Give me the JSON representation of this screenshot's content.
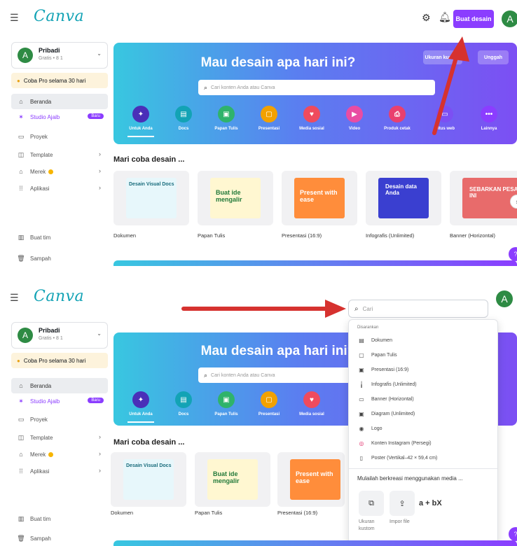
{
  "header": {
    "logo": "Canva",
    "create_button": "Buat desain",
    "avatar_letter": "A",
    "icons": [
      "menu-icon",
      "gear-icon",
      "bell-icon"
    ]
  },
  "sidebar": {
    "account": {
      "avatar_letter": "A",
      "name": "Pribadi",
      "plan": "Gratis • 8 1"
    },
    "pro_promo": "Coba Pro selama 30 hari",
    "items": [
      {
        "label": "Beranda",
        "icon": "home-icon"
      },
      {
        "label": "Studio Ajaib",
        "icon": "sparkle-icon",
        "badge": "Baru"
      },
      {
        "label": "Proyek",
        "icon": "folder-icon"
      },
      {
        "label": "Template",
        "icon": "template-icon"
      },
      {
        "label": "Merek",
        "icon": "brand-icon"
      },
      {
        "label": "Aplikasi",
        "icon": "apps-icon"
      }
    ],
    "footer_items": [
      {
        "label": "Buat tim",
        "icon": "team-icon"
      },
      {
        "label": "Sampah",
        "icon": "trash-icon"
      }
    ]
  },
  "hero": {
    "title": "Mau desain apa hari ini?",
    "search_placeholder": "Cari konten Anda atau Canva",
    "custom_size_button": "Ukuran kustom",
    "upload_button": "Unggah",
    "categories": [
      {
        "label": "Untuk Anda",
        "icon": "sparkle-icon",
        "color": "#4a2fb8"
      },
      {
        "label": "Docs",
        "icon": "docs-icon",
        "color": "#13a3b5"
      },
      {
        "label": "Papan Tulis",
        "icon": "whiteboard-icon",
        "color": "#2fb36b"
      },
      {
        "label": "Presentasi",
        "icon": "presentation-icon",
        "color": "#f2a100"
      },
      {
        "label": "Media sosial",
        "icon": "heart-icon",
        "color": "#ef4b5d"
      },
      {
        "label": "Video",
        "icon": "video-icon",
        "color": "#e94ca3"
      },
      {
        "label": "Produk cetak",
        "icon": "print-icon",
        "color": "#e9406e"
      },
      {
        "label": "Situs web",
        "icon": "website-icon",
        "color": "#7c4ff3"
      },
      {
        "label": "Lainnya",
        "icon": "more-icon",
        "color": "#8b3dff"
      }
    ],
    "categories_panel2": [
      {
        "label": "Untuk Anda"
      },
      {
        "label": "Docs"
      },
      {
        "label": "Papan Tulis"
      },
      {
        "label": "Presentasi"
      },
      {
        "label": "Media sosial"
      }
    ]
  },
  "design_section": {
    "title": "Mari coba desain ...",
    "cards": [
      {
        "label": "Dokumen",
        "thumb_text": "Desain Visual Docs"
      },
      {
        "label": "Papan Tulis",
        "thumb_text": "Buat ide mengalir"
      },
      {
        "label": "Presentasi (16:9)",
        "thumb_text": "Present with ease"
      },
      {
        "label": "Infografis (Unlimited)",
        "thumb_text": "Desain data Anda"
      },
      {
        "label": "Banner (Horizontal)",
        "thumb_text": "SEBARKAN PESAN INI"
      }
    ]
  },
  "search_dropdown": {
    "placeholder": "Cari",
    "section_label": "Disarankan",
    "items": [
      {
        "label": "Dokumen",
        "icon": "document-icon"
      },
      {
        "label": "Papan Tulis",
        "icon": "whiteboard-icon"
      },
      {
        "label": "Presentasi (16:9)",
        "icon": "presentation-icon"
      },
      {
        "label": "Infografis (Unlimited)",
        "icon": "chart-icon"
      },
      {
        "label": "Banner (Horizontal)",
        "icon": "banner-icon"
      },
      {
        "label": "Diagram (Unlimited)",
        "icon": "diagram-icon"
      },
      {
        "label": "Logo",
        "icon": "logo-icon"
      },
      {
        "label": "Konten Instagram (Persegi)",
        "icon": "instagram-icon"
      },
      {
        "label": "Poster (Vertikal–42 × 59,4 cm)",
        "icon": "poster-icon"
      }
    ],
    "media_title": "Mulailah berkreasi menggunakan media ...",
    "tiles": [
      {
        "label": "Ukuran kustom",
        "icon": "resize-icon"
      },
      {
        "label": "Impor file",
        "icon": "upload-icon"
      }
    ],
    "formula": "a + bX"
  },
  "annotations": {
    "arrow_color": "#d6322f"
  }
}
